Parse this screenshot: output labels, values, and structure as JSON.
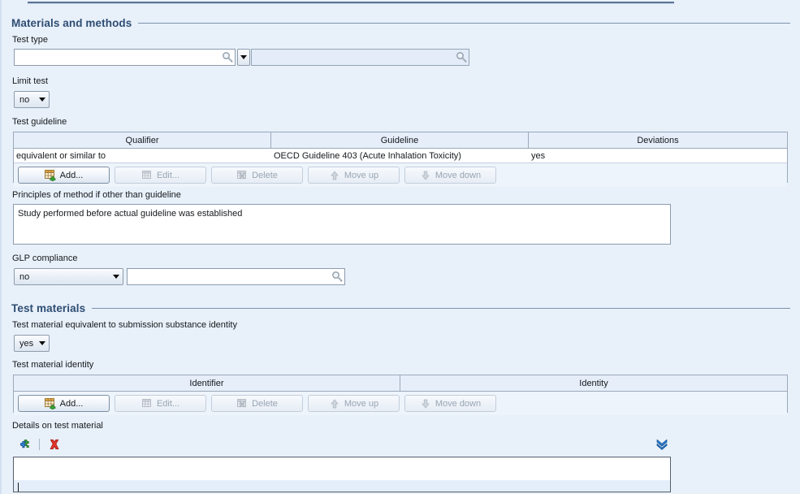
{
  "sections": [
    {
      "id": "materials_and_methods",
      "title": "Materials and methods"
    },
    {
      "id": "test_materials",
      "title": "Test materials"
    }
  ],
  "materials_and_methods": {
    "test_type": {
      "label": "Test type",
      "value": "",
      "picker_icon": "search-icon",
      "dropdown_icon": "chevron-down-icon",
      "secondary_value": "",
      "secondary_picker_icon": "search-icon"
    },
    "limit_test": {
      "label": "Limit test",
      "value": "no",
      "dropdown_icon": "chevron-down-icon"
    },
    "test_guideline": {
      "label": "Test guideline",
      "columns": [
        "Qualifier",
        "Guideline",
        "Deviations"
      ],
      "rows": [
        [
          "equivalent or similar to",
          "OECD Guideline 403 (Acute Inhalation Toxicity)",
          "yes"
        ]
      ],
      "buttons": [
        {
          "label": "Add...",
          "icon": "table-add-icon",
          "state": "enabled"
        },
        {
          "label": "Edit...",
          "icon": "table-edit-icon",
          "state": "disabled"
        },
        {
          "label": "Delete",
          "icon": "table-delete-icon",
          "state": "disabled"
        },
        {
          "label": "Move up",
          "icon": "arrow-up-icon",
          "state": "disabled"
        },
        {
          "label": "Move down",
          "icon": "arrow-down-icon",
          "state": "disabled"
        }
      ]
    },
    "principles_of_method": {
      "label": "Principles of method if other than guideline",
      "value": "Study performed before actual guideline was established"
    },
    "glp_compliance": {
      "label": "GLP compliance",
      "value": "no",
      "dropdown_icon": "chevron-down-icon",
      "remarks_value": "",
      "remarks_picker_icon": "search-icon"
    }
  },
  "test_materials": {
    "equivalent_to_submission": {
      "label": "Test material equivalent to submission substance identity",
      "value": "yes",
      "dropdown_icon": "chevron-down-icon"
    },
    "test_material_identity": {
      "label": "Test material identity",
      "columns": [
        "Identifier",
        "Identity"
      ],
      "rows": [],
      "buttons": [
        {
          "label": "Add...",
          "icon": "table-add-icon",
          "state": "enabled"
        },
        {
          "label": "Edit...",
          "icon": "table-edit-icon",
          "state": "disabled"
        },
        {
          "label": "Delete",
          "icon": "table-delete-icon",
          "state": "disabled"
        },
        {
          "label": "Move up",
          "icon": "arrow-up-icon",
          "state": "disabled"
        },
        {
          "label": "Move down",
          "icon": "arrow-down-icon",
          "state": "disabled"
        }
      ]
    },
    "details_on_test_material": {
      "label": "Details on test material",
      "toolbar": [
        {
          "icon": "puzzle-insert-icon",
          "name": "insert-template-button"
        },
        {
          "icon": "red-x-delete-icon",
          "name": "clear-content-button"
        }
      ],
      "expand_icon": "double-chevron-down-icon",
      "value": ""
    }
  },
  "colors": {
    "background": "#e8f0fa",
    "section_title": "#2e4d73",
    "rule": "#7d93ad",
    "field_border": "#8c9cad",
    "readonly_field": "#e3ecf8",
    "accent_blue": "#1f6fd0",
    "delete_red": "#d6342c",
    "add_green": "#37a437"
  }
}
